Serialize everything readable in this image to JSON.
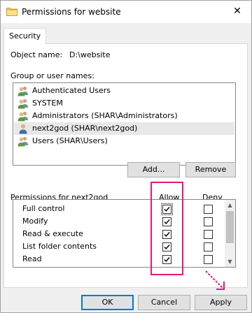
{
  "window": {
    "title": "Permissions for website",
    "close_glyph": "✕",
    "folder_icon": "folder-icon"
  },
  "tabs": [
    {
      "label": "Security"
    }
  ],
  "object": {
    "label": "Object name:",
    "value": "D:\\website"
  },
  "groups": {
    "label": "Group or user names:",
    "items": [
      {
        "label": "Authenticated Users",
        "icon": "users-group-icon"
      },
      {
        "label": "SYSTEM",
        "icon": "users-group-icon"
      },
      {
        "label": "Administrators (SHAR\\Administrators)",
        "icon": "users-group-icon"
      },
      {
        "label": "next2god (SHAR\\next2god)",
        "icon": "user-icon",
        "selected": true
      },
      {
        "label": "Users (SHAR\\Users)",
        "icon": "users-group-icon"
      }
    ]
  },
  "buttons": {
    "add": "Add...",
    "remove": "Remove",
    "ok": "OK",
    "cancel": "Cancel",
    "apply": "Apply"
  },
  "permissions": {
    "header": "Permissions for next2god",
    "allow_header": "Allow",
    "deny_header": "Deny",
    "rows": [
      {
        "label": "Full control",
        "allow": true,
        "deny": false
      },
      {
        "label": "Modify",
        "allow": true,
        "deny": false
      },
      {
        "label": "Read & execute",
        "allow": true,
        "deny": false
      },
      {
        "label": "List folder contents",
        "allow": true,
        "deny": false
      },
      {
        "label": "Read",
        "allow": true,
        "deny": false
      },
      {
        "label": "",
        "allow": false,
        "deny": false
      }
    ]
  },
  "colors": {
    "annotation": "#e0197d",
    "default_button_border": "#0078d7",
    "selection": "#e8e8e8"
  }
}
